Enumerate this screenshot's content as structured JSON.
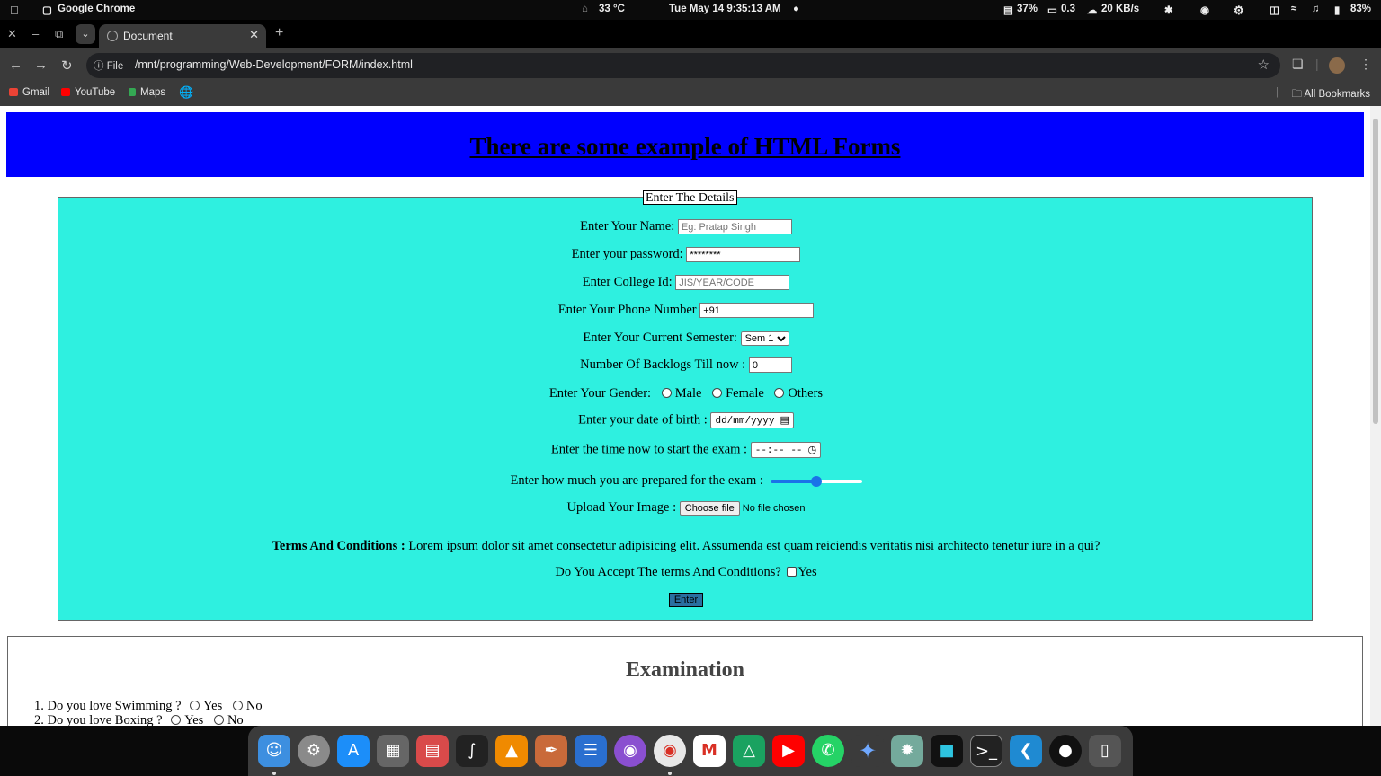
{
  "system_bar": {
    "app_name": "Google Chrome",
    "weather": "33 °C",
    "datetime": "Tue May 14  9:35:13 AM",
    "cpu": "37%",
    "load": "0.3",
    "network": "20 KB/s",
    "battery": "83%"
  },
  "browser": {
    "tab_title": "Document",
    "url_chip": "File",
    "url": "/mnt/programming/Web-Development/FORM/index.html",
    "bookmarks": [
      {
        "label": "Gmail",
        "color": "#ea4335"
      },
      {
        "label": "YouTube",
        "color": "#ff0000"
      },
      {
        "label": "Maps",
        "color": "#34a853"
      }
    ],
    "all_bookmarks": "All Bookmarks"
  },
  "page": {
    "banner_title": "There are some example of HTML Forms",
    "banner_color": "#0000ff",
    "form": {
      "background": "#2ef0e0",
      "legend": "Enter The Details",
      "name_label": "Enter Your Name:",
      "name_placeholder": "Eg: Pratap Singh",
      "password_label": "Enter your password:",
      "password_value": "********",
      "college_label": "Enter College Id:",
      "college_placeholder": "JIS/YEAR/CODE",
      "phone_label": "Enter Your Phone Number",
      "phone_value": "+91",
      "semester_label": "Enter Your Current Semester:",
      "semester_selected": "Sem 1",
      "backlogs_label": "Number Of Backlogs Till now :",
      "backlogs_value": "0",
      "gender_label": "Enter Your Gender:",
      "gender_options": [
        "Male",
        "Female",
        "Others"
      ],
      "dob_label": "Enter your date of birth :",
      "dob_placeholder": "dd/mm/yyyy",
      "time_label": "Enter the time now to start the exam :",
      "time_placeholder": "--:-- --",
      "prep_label": "Enter how much you are prepared for the exam :",
      "prep_level": 0.5,
      "upload_label": "Upload Your Image :",
      "upload_button": "Choose file",
      "upload_status": "No file chosen",
      "terms_heading": "Terms And Conditions :",
      "terms_text": "Lorem ipsum dolor sit amet consectetur adipisicing elit. Assumenda est quam reiciendis veritatis nisi architecto tenetur iure in a qui?",
      "accept_label": "Do You Accept The terms And Conditions?",
      "accept_option": "Yes",
      "submit_label": "Enter"
    },
    "exam": {
      "title": "Examination",
      "questions": [
        {
          "text": "1. Do you love Swimming ?",
          "options": [
            "Yes",
            "No"
          ]
        },
        {
          "text": "2. Do you love Boxing ?",
          "options": [
            "Yes",
            "No"
          ]
        }
      ]
    }
  },
  "dock_icons": [
    "finder-icon",
    "settings-icon",
    "app-store-icon",
    "launchpad-icon",
    "files-icon",
    "inkscape-icon",
    "vlc-icon",
    "paint-icon",
    "writer-icon",
    "firefox-icon",
    "chrome-icon",
    "gmail-icon",
    "drive-icon",
    "youtube-icon",
    "whatsapp-icon",
    "gemini-icon",
    "chatgpt-icon",
    "cursor-icon",
    "terminal-icon",
    "vscode-icon",
    "github-icon",
    "trash-icon"
  ]
}
